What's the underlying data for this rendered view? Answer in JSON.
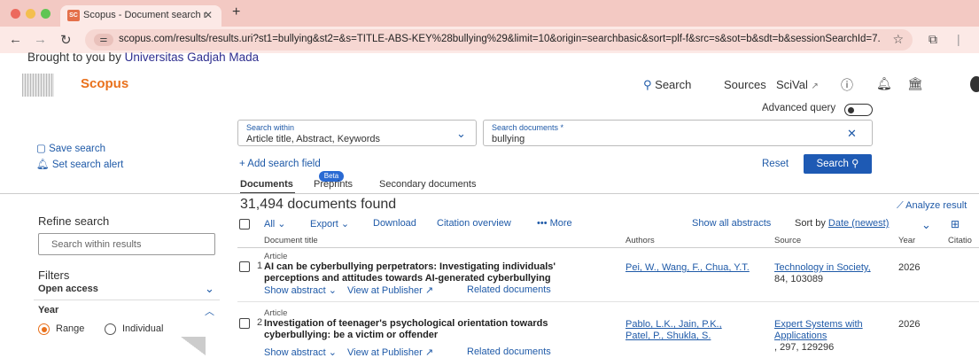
{
  "browser": {
    "tab_title": "Scopus - Document search r",
    "tab_favicon": "SC",
    "url": "scopus.com/results/results.uri?st1=bullying&st2=&s=TITLE-ABS-KEY%28bullying%29&limit=10&origin=searchbasic&sort=plf-f&src=s&sot=b&sdt=b&sessionSearchId=7...",
    "dot_colors": [
      "#ec6a5e",
      "#f4bf4f",
      "#61c554"
    ]
  },
  "header": {
    "brought_prefix": "Brought to you by",
    "institution": "Universitas Gadjah Mada",
    "brand": "Scopus",
    "nav_search": "Search",
    "nav_sources": "Sources",
    "nav_scival": "SciVal",
    "nav_scival_icon": "↗"
  },
  "search": {
    "advanced_query": "Advanced query",
    "within_label": "Search within",
    "within_value": "Article title, Abstract, Keywords",
    "documents_label": "Search documents *",
    "documents_value": "bullying",
    "add_field": "+ Add search field",
    "reset": "Reset",
    "search_button": "Search",
    "save_search": "Save search",
    "set_alert": "Set search alert"
  },
  "tabs": {
    "documents": "Documents",
    "preprints": "Preprints",
    "beta": "Beta",
    "secondary": "Secondary documents"
  },
  "results": {
    "count_label": "31,494 documents found",
    "analyze": "Analyze result",
    "toolbar": {
      "all": "All",
      "export": "Export",
      "download": "Download",
      "citation_overview": "Citation overview",
      "more": "••• More",
      "show_all_abstracts": "Show all abstracts",
      "sort_by": "Sort by",
      "sort_value": "Date (newest)"
    },
    "columns": [
      "Document title",
      "Authors",
      "Source",
      "Year",
      "Citatio"
    ],
    "rows": [
      {
        "index": "1",
        "type": "Article",
        "title_line1": "AI can be cyberbullying perpetrators: Investigating individuals'",
        "title_line2": "perceptions and attitudes towards AI-generated cyberbullying",
        "authors_line1": "Pei, W., Wang, F., Chua, Y.T.",
        "authors_line2": "",
        "source_line1": "Technology in Society,",
        "source_line2": "84, 103089",
        "source_line3": "",
        "year": "2026",
        "show_abstract": "Show abstract",
        "view_publisher": "View at Publisher",
        "related": "Related documents"
      },
      {
        "index": "2",
        "type": "Article",
        "title_line1": "Investigation of teenager's psychological orientation towards",
        "title_line2": "cyberbullying: be a victim or offender",
        "authors_line1": "Pablo, L.K., Jain, P.K.,",
        "authors_line2": "Patel, P., Shukla, S.",
        "source_line1": "Expert Systems with",
        "source_line2": "Applications",
        "source_line3": ", 297, 129296",
        "year": "2026",
        "show_abstract": "Show abstract",
        "view_publisher": "View at Publisher",
        "related": "Related documents"
      }
    ]
  },
  "sidebar": {
    "refine": "Refine search",
    "search_within_placeholder": "Search within results",
    "filters": "Filters",
    "open_access": "Open access",
    "year": "Year",
    "range": "Range",
    "individual": "Individual",
    "selected_mode": "Range"
  },
  "colors": {
    "accent": "#1e5ab4",
    "brand": "#e9711c",
    "tab_strip": "#f3c9c3"
  }
}
